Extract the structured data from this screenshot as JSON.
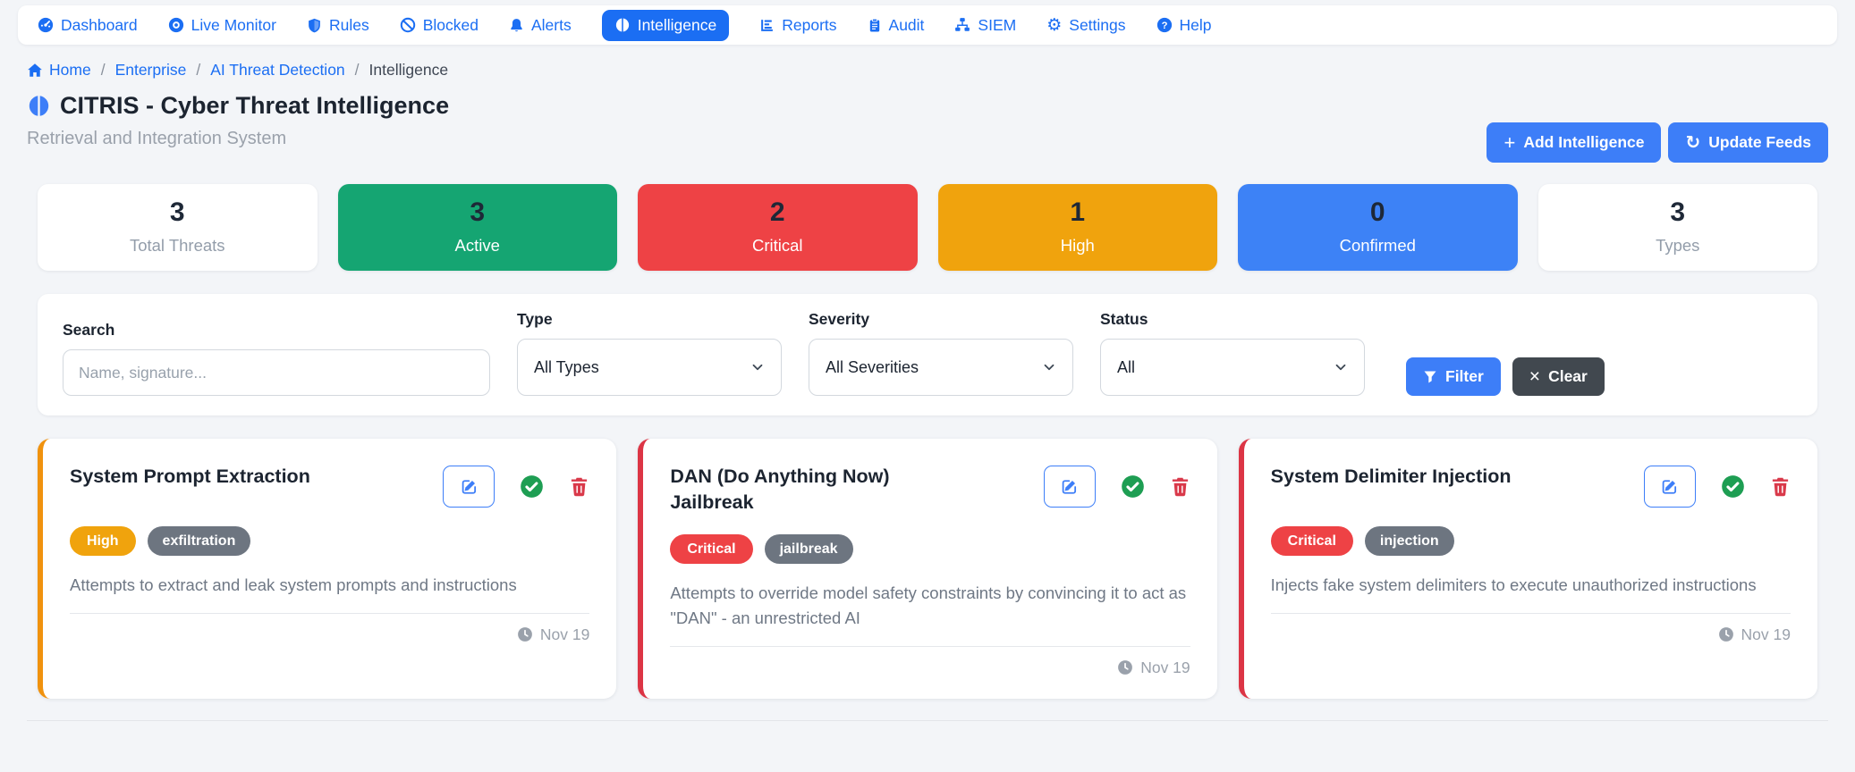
{
  "nav": {
    "items": [
      {
        "label": "Dashboard",
        "icon": "speedometer-icon",
        "active": false
      },
      {
        "label": "Live Monitor",
        "icon": "monitor-icon",
        "active": false
      },
      {
        "label": "Rules",
        "icon": "shield-icon",
        "active": false
      },
      {
        "label": "Blocked",
        "icon": "slash-circle-icon",
        "active": false
      },
      {
        "label": "Alerts",
        "icon": "bell-icon",
        "active": false
      },
      {
        "label": "Intelligence",
        "icon": "brain-icon",
        "active": true
      },
      {
        "label": "Reports",
        "icon": "bar-chart-icon",
        "active": false
      },
      {
        "label": "Audit",
        "icon": "clipboard-icon",
        "active": false
      },
      {
        "label": "SIEM",
        "icon": "diagram-icon",
        "active": false
      },
      {
        "label": "Settings",
        "icon": "gear-icon",
        "active": false
      },
      {
        "label": "Help",
        "icon": "question-circle-icon",
        "active": false
      }
    ]
  },
  "breadcrumb": {
    "items": [
      {
        "label": "Home"
      },
      {
        "label": "Enterprise"
      },
      {
        "label": "AI Threat Detection"
      },
      {
        "label": "Intelligence"
      }
    ],
    "separator": "/"
  },
  "header": {
    "title": "CITRIS - Cyber Threat Intelligence",
    "subtitle": "Retrieval and Integration System",
    "add_button": "Add Intelligence",
    "update_button": "Update Feeds"
  },
  "stats": [
    {
      "value": "3",
      "label": "Total Threats",
      "variant": "white"
    },
    {
      "value": "3",
      "label": "Active",
      "variant": "green"
    },
    {
      "value": "2",
      "label": "Critical",
      "variant": "red"
    },
    {
      "value": "1",
      "label": "High",
      "variant": "orange"
    },
    {
      "value": "0",
      "label": "Confirmed",
      "variant": "blue"
    },
    {
      "value": "3",
      "label": "Types",
      "variant": "white"
    }
  ],
  "filters": {
    "search": {
      "label": "Search",
      "placeholder": "Name, signature...",
      "value": ""
    },
    "type": {
      "label": "Type",
      "value": "All Types"
    },
    "severity": {
      "label": "Severity",
      "value": "All Severities"
    },
    "status": {
      "label": "Status",
      "value": "All"
    },
    "filter_button": "Filter",
    "clear_button": "Clear"
  },
  "threats": [
    {
      "title": "System Prompt Extraction",
      "severity": "High",
      "tag": "exfiltration",
      "description": "Attempts to extract and leak system prompts and instructions",
      "date": "Nov 19",
      "accent": "#f0920e"
    },
    {
      "title": "DAN (Do Anything Now) Jailbreak",
      "severity": "Critical",
      "tag": "jailbreak",
      "description": "Attempts to override model safety constraints by convincing it to act as \"DAN\" - an unrestricted AI",
      "date": "Nov 19",
      "accent": "#dc3545"
    },
    {
      "title": "System Delimiter Injection",
      "severity": "Critical",
      "tag": "injection",
      "description": "Injects fake system delimiters to execute unauthorized instructions",
      "date": "Nov 19",
      "accent": "#dc3545"
    }
  ],
  "colors": {
    "nav_blue": "#1b6ef3",
    "button_blue": "#3d7ef8",
    "success_green": "#15a572",
    "danger_red": "#ee4245",
    "warning_orange": "#f0a30d",
    "confirmed_blue": "#3d82f6",
    "tag_gray": "#6d7580",
    "check_green": "#1e9e53",
    "trash_red": "#d9394a",
    "accent_orange": "#f0920e",
    "accent_red": "#dc3545"
  }
}
